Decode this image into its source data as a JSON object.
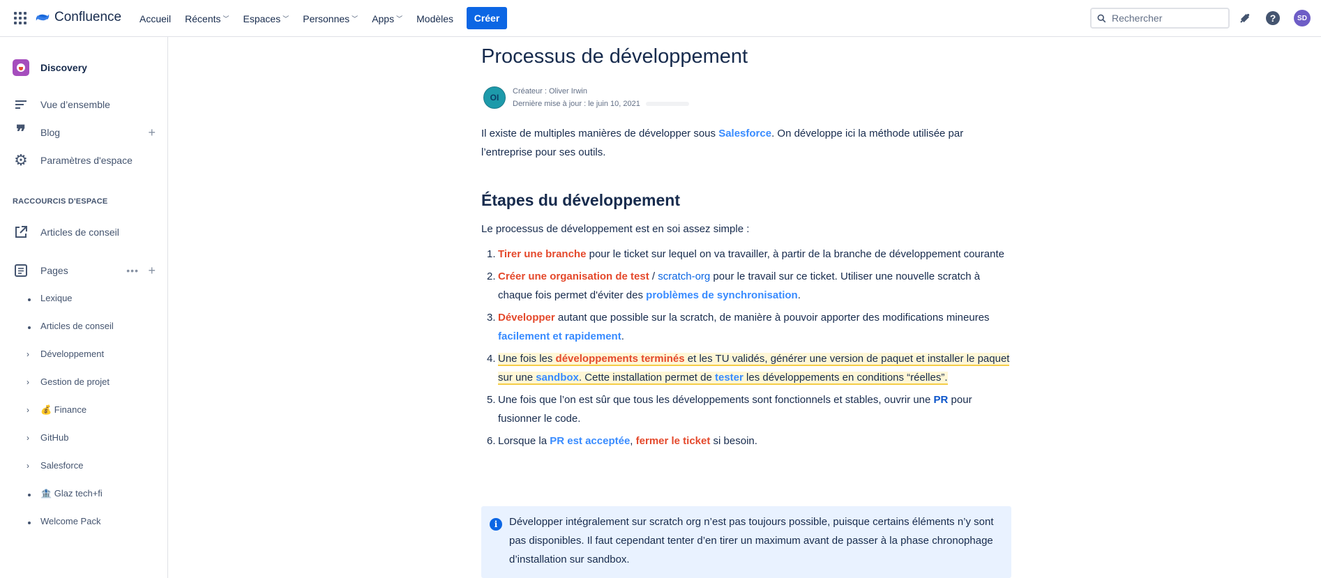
{
  "topbar": {
    "app_name": "Confluence",
    "nav": [
      {
        "label": "Accueil",
        "has_dropdown": false
      },
      {
        "label": "Récents",
        "has_dropdown": true
      },
      {
        "label": "Espaces",
        "has_dropdown": true
      },
      {
        "label": "Personnes",
        "has_dropdown": true
      },
      {
        "label": "Apps",
        "has_dropdown": true
      },
      {
        "label": "Modèles",
        "has_dropdown": false
      }
    ],
    "create_label": "Créer",
    "search_placeholder": "Rechercher",
    "user_initials": "SD",
    "accent": "#0c66e4"
  },
  "sidebar": {
    "space_name": "Discovery",
    "items": [
      {
        "label": "Vue d’ensemble",
        "icon": "overview-icon"
      },
      {
        "label": "Blog",
        "icon": "quote-icon"
      },
      {
        "label": "Paramètres d'espace",
        "icon": "gear-icon"
      }
    ],
    "shortcuts_label": "RACCOURCIS D'ESPACE",
    "shortcut": {
      "label": "Articles de conseil",
      "icon": "external-link-icon"
    },
    "pages_label": "Pages",
    "tree": [
      {
        "label": "Lexique",
        "kind": "leaf"
      },
      {
        "label": "Articles de conseil",
        "kind": "leaf"
      },
      {
        "label": "Développement",
        "kind": "expandable"
      },
      {
        "label": "Gestion de projet",
        "kind": "expandable"
      },
      {
        "label": "💰 Finance",
        "kind": "expandable"
      },
      {
        "label": "GitHub",
        "kind": "expandable"
      },
      {
        "label": "Salesforce",
        "kind": "expandable"
      },
      {
        "label": "🏦 Glaz tech+fi",
        "kind": "leaf"
      },
      {
        "label": "Welcome Pack",
        "kind": "leaf"
      }
    ]
  },
  "page": {
    "title": "Processus de développement",
    "author_initials": "OI",
    "creator": "Créateur : Oliver Irwin",
    "updated": "Dernière mise à jour : le juin 10, 2021",
    "intro": {
      "a": "Il existe de multiples manières de développer sous ",
      "b": "Salesforce",
      "c": ". On développe ici la méthode utilisée par l’entreprise pour ses outils."
    },
    "heading": "Étapes du développement",
    "lead": "Le processus de développement est en soi assez simple :",
    "steps": {
      "s1": {
        "n": "1.",
        "a": "Tirer une branche",
        "b": " pour le ticket sur lequel on va travailler, à partir de la branche de développement courante"
      },
      "s2": {
        "n": "2.",
        "a": "Créer une organisation de test",
        "b": " / ",
        "c": "scratch-org",
        "d": " pour le travail sur ce ticket. Utiliser une nouvelle scratch à chaque fois permet d'éviter des ",
        "e": "problèmes de synchronisation",
        "f": "."
      },
      "s3": {
        "n": "3.",
        "a": "Développer",
        "b": " autant que possible sur la scratch, de manière à pouvoir apporter des modifications mineures ",
        "c": "facilement et rapidement",
        "d": "."
      },
      "s4": {
        "n": "4.",
        "a": "Une fois les ",
        "b": "développements terminés",
        "c": " et les TU validés, générer une version de paquet et installer le paquet sur une ",
        "d": "sandbox",
        "e": ". Cette installation permet de ",
        "f": "tester",
        "g": " les développements en conditions “réelles”."
      },
      "s5": {
        "n": "5.",
        "a": "Une fois que l’on est sûr que tous les développements sont fonctionnels et stables, ouvrir une ",
        "b": "PR",
        "c": " pour fusionner le code."
      },
      "s6": {
        "n": "6.",
        "a": "Lorsque la ",
        "b": "PR est acceptée",
        "c": ", ",
        "d": "fermer le ticket",
        "e": " si besoin."
      }
    },
    "info": "Développer intégralement sur scratch org n’est pas toujours possible, puisque certains éléments n’y sont pas disponibles. Il faut cependant tenter d’en tirer un maximum avant de passer à la phase chronophage d’installation sur sandbox."
  }
}
